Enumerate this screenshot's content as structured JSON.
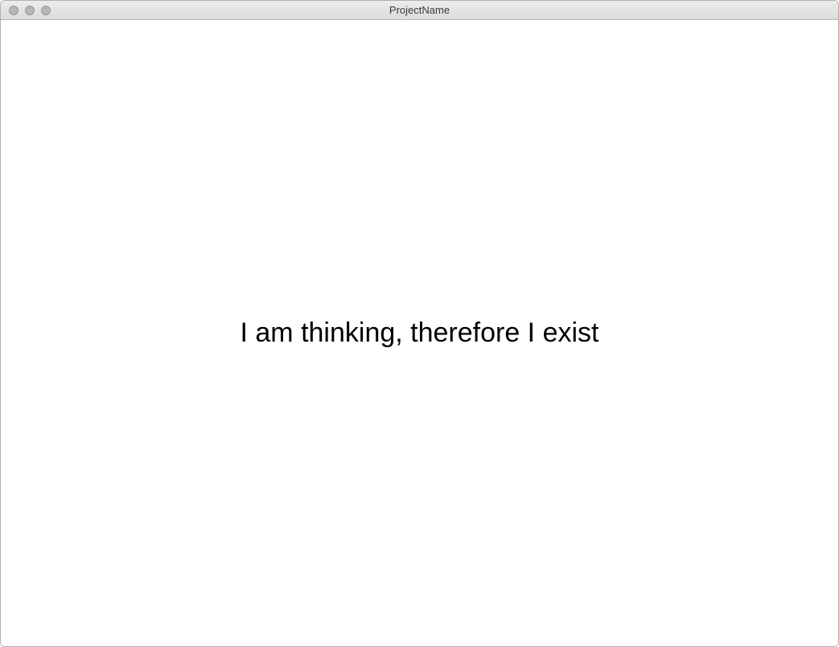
{
  "window": {
    "title": "ProjectName"
  },
  "content": {
    "message": "I am thinking, therefore I exist"
  }
}
